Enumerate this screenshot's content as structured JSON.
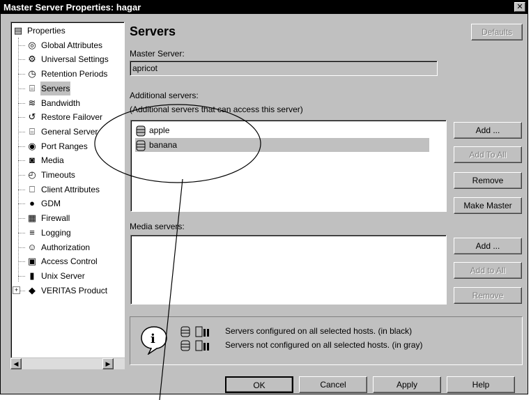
{
  "window": {
    "title": "Master Server Properties: hagar",
    "close_label": "✕"
  },
  "tree": {
    "items": [
      {
        "label": "Properties",
        "icon": "properties-icon"
      },
      {
        "label": "Global Attributes",
        "icon": "globe-icon"
      },
      {
        "label": "Universal Settings",
        "icon": "settings-icon"
      },
      {
        "label": "Retention Periods",
        "icon": "clock-icon"
      },
      {
        "label": "Servers",
        "icon": "server-icon",
        "selected": true
      },
      {
        "label": "Bandwidth",
        "icon": "bandwidth-icon"
      },
      {
        "label": "Restore Failover",
        "icon": "failover-icon"
      },
      {
        "label": "General Server",
        "icon": "server-icon"
      },
      {
        "label": "Port Ranges",
        "icon": "port-icon"
      },
      {
        "label": "Media",
        "icon": "media-icon"
      },
      {
        "label": "Timeouts",
        "icon": "timer-icon"
      },
      {
        "label": "Client Attributes",
        "icon": "client-icon"
      },
      {
        "label": "GDM",
        "icon": "gdm-icon"
      },
      {
        "label": "Firewall",
        "icon": "firewall-icon"
      },
      {
        "label": "Logging",
        "icon": "log-icon"
      },
      {
        "label": "Authorization",
        "icon": "user-icon"
      },
      {
        "label": "Access Control",
        "icon": "access-icon"
      },
      {
        "label": "Unix Server",
        "icon": "unix-icon"
      },
      {
        "label": "VERITAS Product",
        "icon": "product-icon",
        "expand": "+"
      }
    ]
  },
  "main": {
    "heading": "Servers",
    "defaults_button": "Defaults",
    "master_label": "Master Server:",
    "master_value": "apricot",
    "additional_label": "Additional servers:",
    "additional_hint": "(Additional servers that can access this server)",
    "additional_servers": [
      {
        "name": "apple"
      },
      {
        "name": "banana"
      }
    ],
    "additional_buttons": {
      "add": "Add ...",
      "add_to_all": "Add To All",
      "remove": "Remove",
      "make_master": "Make Master"
    },
    "media_label": "Media servers:",
    "media_buttons": {
      "add": "Add ...",
      "add_to_all": "Add to All",
      "remove": "Remove"
    },
    "legend": {
      "black_text": "Servers configured on all selected hosts. (in black)",
      "gray_text": "Servers not configured on all selected hosts. (in gray)"
    }
  },
  "footer": {
    "ok": "OK",
    "cancel": "Cancel",
    "apply": "Apply",
    "help": "Help"
  },
  "colors": {
    "face": "#c0c0c0",
    "title_bg": "#000000",
    "disabled_text": "#808080"
  }
}
